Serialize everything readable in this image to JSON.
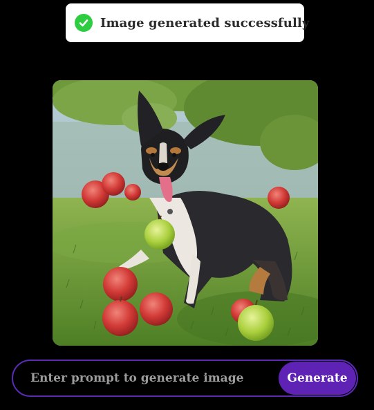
{
  "toast": {
    "icon": "check-circle-icon",
    "message": "Image generated successfully",
    "icon_color": "#2ecc40"
  },
  "generated_image": {
    "subject": "dog-with-apples-photo"
  },
  "prompt": {
    "placeholder": "Enter prompt to generate image",
    "value": "",
    "generate_label": "Generate",
    "accent_color": "#5e22b5"
  }
}
